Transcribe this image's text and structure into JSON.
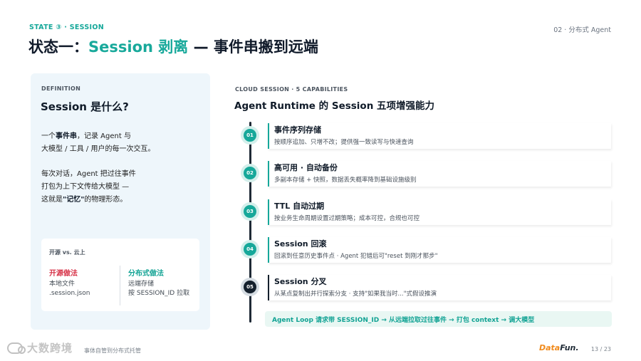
{
  "header": {
    "kicker": "STATE ③ · SESSION",
    "section_tag": "02 · 分布式 Agent",
    "title_prefix": "状态一：",
    "title_accent": "Session 剥离",
    "title_suffix": " — 事件串搬到远端"
  },
  "definition": {
    "label": "DEFINITION",
    "title": "Session 是什么?",
    "p1_pre": "一个",
    "p1_bold": "事件串",
    "p1_line1_post": "，记录 Agent 与",
    "p1_line2": "大模型 / 工具 / 用户的每一次交互。",
    "p2_line1": "每次对话，Agent 把过往事件",
    "p2_line2": "打包为上下文传给大模型 —",
    "p2_line3_pre": "这就是",
    "p2_line3_bold": "\"记忆\"",
    "p2_line3_post": "的物理形态。",
    "compare": {
      "label": "开源 vs. 云上",
      "left_head": "开源做法",
      "left_lines": [
        "本地文件",
        ".session.json"
      ],
      "right_head": "分布式做法",
      "right_lines": [
        "远端存储",
        "按 SESSION_ID 拉取"
      ]
    }
  },
  "capabilities": {
    "label": "CLOUD SESSION · 5 CAPABILITIES",
    "title": "Agent Runtime 的 Session 五项增强能力",
    "steps": [
      {
        "num": "01",
        "title": "事件序列存储",
        "desc": "按顺序追加、只增不改；提供强一致读写与快速查询"
      },
      {
        "num": "02",
        "title": "高可用 · 自动备份",
        "desc": "多副本存储 + 快照，数据丢失概率降到基础设施级别"
      },
      {
        "num": "03",
        "title": "TTL 自动过期",
        "desc": "按业务生命周期设置过期策略；成本可控，合规也可控"
      },
      {
        "num": "04",
        "title": "Session 回滚",
        "desc": "回滚到任意历史事件点 · Agent 犯错后可\"reset 到刚才那步\""
      },
      {
        "num": "05",
        "title": "Session 分叉",
        "desc": "从某点复制出并行探索分支 · 支持\"如果我当时...\"式假设推演"
      }
    ],
    "loop": "Agent Loop 请求带 SESSION_ID → 从远端拉取过往事件 → 打包 context → 调大模型"
  },
  "footer": {
    "watermark": "大数跨境",
    "note": "事体自管到分布式托管",
    "brand_a": "Data",
    "brand_b": "Fun.",
    "page": "13 / 23"
  },
  "colors": {
    "accent": "#16a89a",
    "red": "#d62f45",
    "dark": "#14202c",
    "card_bg": "#eef6fb"
  }
}
